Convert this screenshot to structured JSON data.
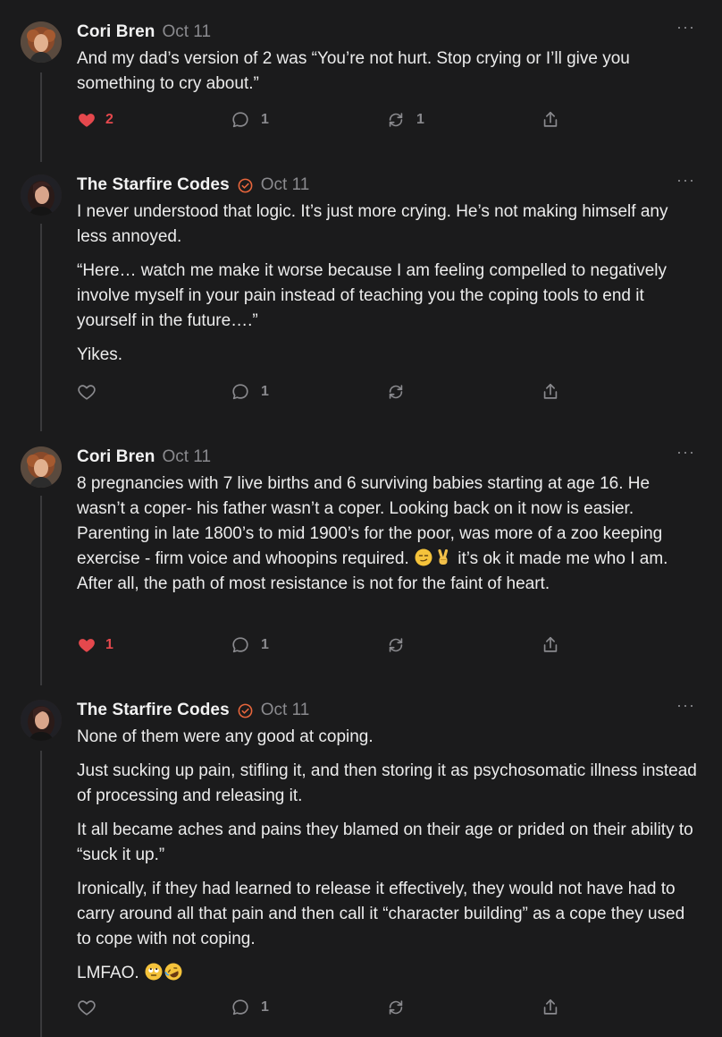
{
  "colors": {
    "background": "#1b1b1c",
    "text": "#ececec",
    "muted": "#8a8a8e",
    "like_red": "#e5484d",
    "verified_orange": "#e8663c"
  },
  "comments": [
    {
      "author": "Cori Bren",
      "verified": false,
      "date": "Oct 11",
      "more": "···",
      "paragraphs": [
        "And my dad’s version of 2 was “You’re not hurt. Stop crying or I’ll give you something to cry about.”"
      ],
      "likes": "2",
      "liked": true,
      "replies": "1",
      "restacks": "1"
    },
    {
      "author": "The Starfire Codes",
      "verified": true,
      "date": "Oct 11",
      "more": "···",
      "paragraphs": [
        "I never understood that logic. It’s just more crying. He’s not making himself any less annoyed.",
        "“Here… watch me make it worse because I am feeling compelled to negatively involve myself in your pain instead of teaching you the coping tools to end it yourself in the future….”",
        "Yikes."
      ],
      "likes": "",
      "liked": false,
      "replies": "1",
      "restacks": ""
    },
    {
      "author": "Cori Bren",
      "verified": false,
      "date": "Oct 11",
      "more": "···",
      "paragraphs": [],
      "p3_part1": "8 pregnancies with 7 live births and 6 surviving babies starting at age 16. He wasn’t a coper- his father wasn’t a coper. Looking back on it now is easier. Parenting in late 1800’s to mid 1900’s for the poor, was more of a zoo keeping exercise - firm voice and whoopins required. ",
      "p3_emojis": [
        "smirking-face",
        "victory-hand"
      ],
      "p3_part2": " it’s ok it made me who I am. After all, the path of most resistance is not for the faint of heart.",
      "likes": "1",
      "liked": true,
      "replies": "1",
      "restacks": ""
    },
    {
      "author": "The Starfire Codes",
      "verified": true,
      "date": "Oct 11",
      "more": "···",
      "paragraphs": [
        "None of them were any good at coping.",
        "Just sucking up pain, stifling it, and then storing it as psychosomatic illness instead of processing and releasing it.",
        "It all became aches and pains they blamed on their age or prided on their ability to “suck it up.”",
        "Ironically, if they had learned to release it effectively, they would not have had to carry around all that pain and then call it “character building” as a cope they used to cope with not coping."
      ],
      "last_text": "LMFAO. ",
      "last_emojis": [
        "eye-roll-face",
        "rofl-face"
      ],
      "likes": "",
      "liked": false,
      "replies": "1",
      "restacks": ""
    }
  ]
}
